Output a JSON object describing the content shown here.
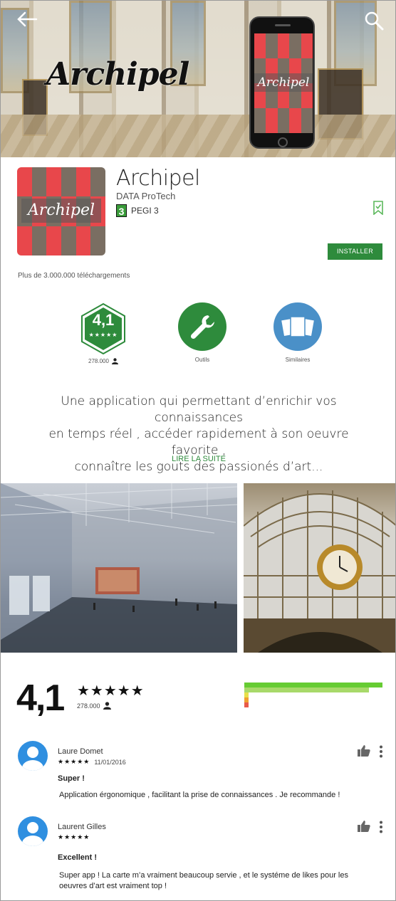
{
  "hero": {
    "logo_text": "Archipel",
    "phone_logo_text": "Archipel"
  },
  "app": {
    "title": "Archipel",
    "developer": "DATA ProTech",
    "pegi_number": "3",
    "pegi_label": "PEGI 3",
    "icon_logo_text": "Archipel",
    "install_label": "INSTALLER",
    "downloads": "Plus de 3.000.000 téléchargements"
  },
  "badges": {
    "rating_value": "4,1",
    "rating_stars": "★★★★★",
    "rating_count": "278.000",
    "tools_label": "Outils",
    "similar_label": "Similaires"
  },
  "description": {
    "line1": "Une application qui permettant d’enrichir vos connaissances",
    "line2": "en temps réel , accéder rapidement à son oeuvre favorite ,",
    "line3": "connaître les gouts des passionés d’art...",
    "read_more": "LIRE LA SUITE"
  },
  "rating_summary": {
    "value": "4,1",
    "stars": "★★★★★",
    "count": "278.000",
    "distribution": [
      {
        "stars": 5,
        "fraction": 1.0,
        "color": "#66cc33"
      },
      {
        "stars": 4,
        "fraction": 0.9,
        "color": "#a8d96a"
      },
      {
        "stars": 3,
        "fraction": 0.03,
        "color": "#e8e04a"
      },
      {
        "stars": 2,
        "fraction": 0.03,
        "color": "#f0a030"
      },
      {
        "stars": 1,
        "fraction": 0.03,
        "color": "#e85a4a"
      }
    ]
  },
  "reviews": [
    {
      "name": "Laure Domet",
      "stars": "★★★★★",
      "date": "11/01/2016",
      "title": "Super !",
      "text": "Application érgonomique , facilitant la prise de connaissances . Je recommande !"
    },
    {
      "name": "Laurent Gilles",
      "stars": "★★★★★",
      "date": "",
      "title": "Excellent !",
      "text": "Super app ! La carte m’a vraiment beaucoup servie , et le systéme de likes pour les oeuvres d’art est vraiment top !"
    }
  ],
  "colors": {
    "accent": "#2e8b3c",
    "mosaic": [
      "#e8474b",
      "#6fc2bd",
      "#7a6e62",
      "#7fc15c"
    ]
  }
}
